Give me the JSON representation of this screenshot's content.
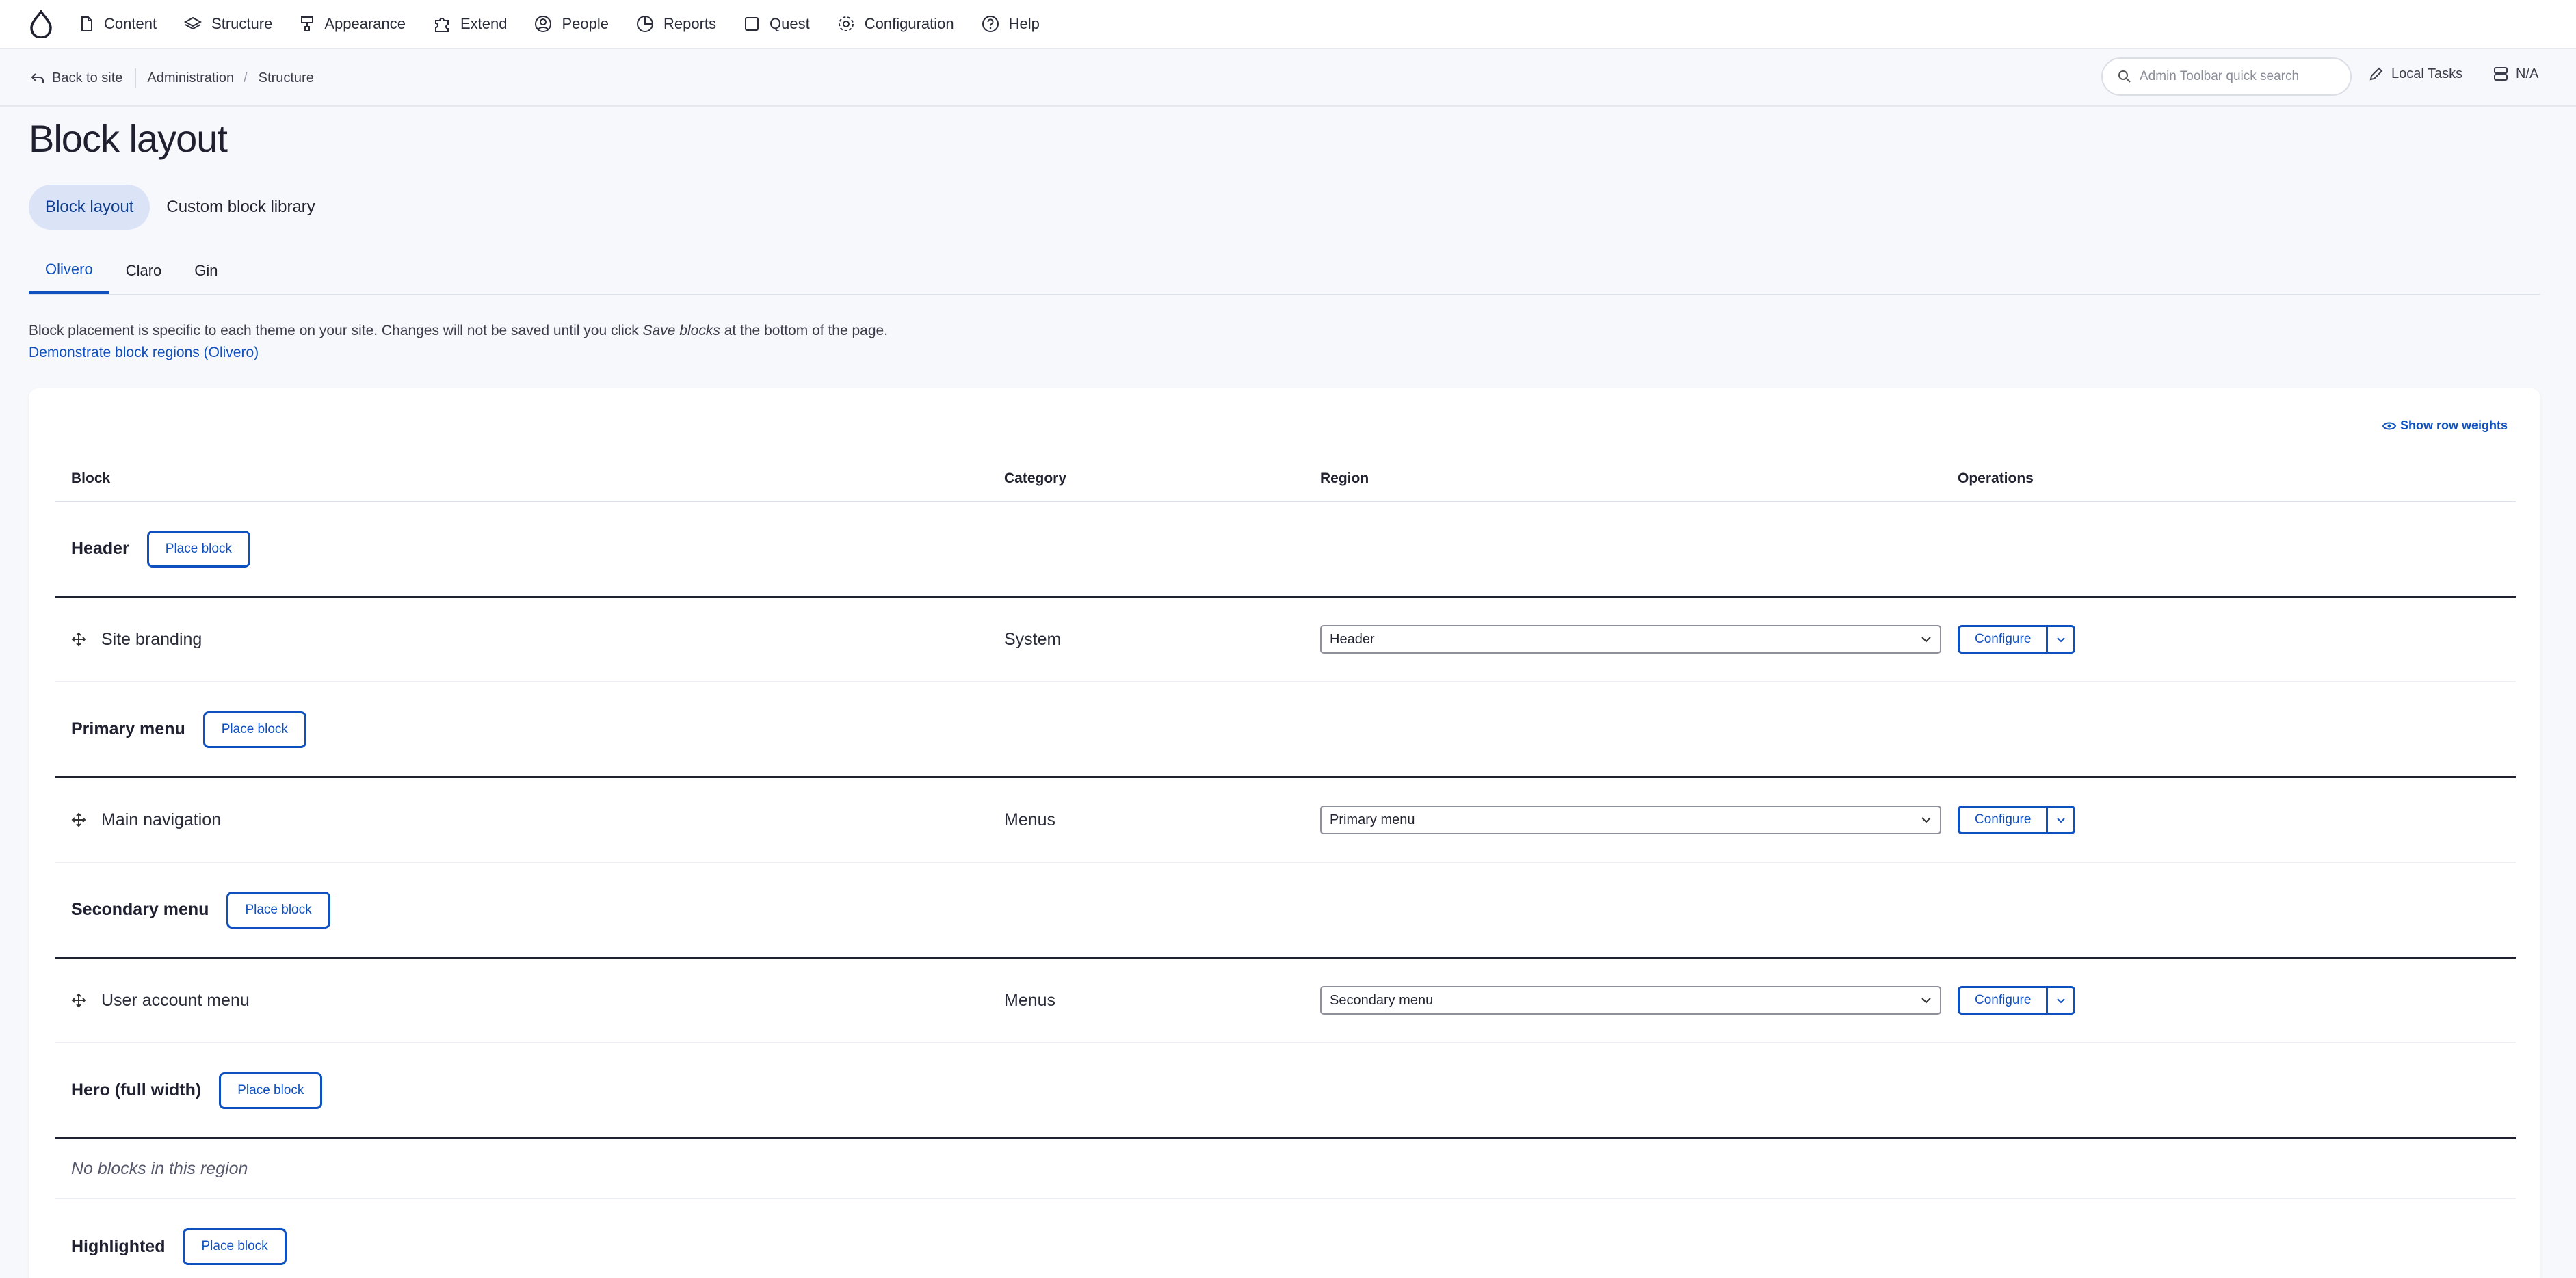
{
  "toolbar": {
    "items": [
      {
        "label": "Content",
        "icon": "file-icon"
      },
      {
        "label": "Structure",
        "icon": "layers-icon"
      },
      {
        "label": "Appearance",
        "icon": "paint-icon"
      },
      {
        "label": "Extend",
        "icon": "puzzle-icon"
      },
      {
        "label": "People",
        "icon": "user-circle-icon"
      },
      {
        "label": "Reports",
        "icon": "pie-chart-icon"
      },
      {
        "label": "Quest",
        "icon": "square-icon"
      },
      {
        "label": "Configuration",
        "icon": "gear-icon"
      },
      {
        "label": "Help",
        "icon": "help-icon"
      }
    ]
  },
  "breadcrumb": {
    "back": "Back to site",
    "items": [
      "Administration",
      "Structure"
    ]
  },
  "search": {
    "placeholder": "Admin Toolbar quick search"
  },
  "local_tasks": "Local Tasks",
  "na": "N/A",
  "page": {
    "title": "Block layout",
    "primary_tabs": [
      "Block layout",
      "Custom block library"
    ],
    "secondary_tabs": [
      "Olivero",
      "Claro",
      "Gin"
    ],
    "description_part1": "Block placement is specific to each theme on your site. Changes will not be saved until you click ",
    "description_em": "Save blocks",
    "description_part2": " at the bottom of the page.",
    "demo_link": "Demonstrate block regions (Olivero)"
  },
  "table": {
    "show_weights": "Show row weights",
    "headers": {
      "block": "Block",
      "category": "Category",
      "region": "Region",
      "operations": "Operations"
    },
    "place_block": "Place block",
    "configure": "Configure",
    "regions": [
      {
        "name": "Header",
        "block": {
          "name": "Site branding",
          "category": "System",
          "region": "Header"
        }
      },
      {
        "name": "Primary menu",
        "block": {
          "name": "Main navigation",
          "category": "Menus",
          "region": "Primary menu"
        }
      },
      {
        "name": "Secondary menu",
        "block": {
          "name": "User account menu",
          "category": "Menus",
          "region": "Secondary menu"
        }
      },
      {
        "name": "Hero (full width)",
        "empty": "No blocks in this region"
      },
      {
        "name": "Highlighted"
      }
    ]
  },
  "colors": {
    "accent": "#0f50c0",
    "active_pill": "#dbe3f7",
    "background": "#f7f8fb"
  }
}
